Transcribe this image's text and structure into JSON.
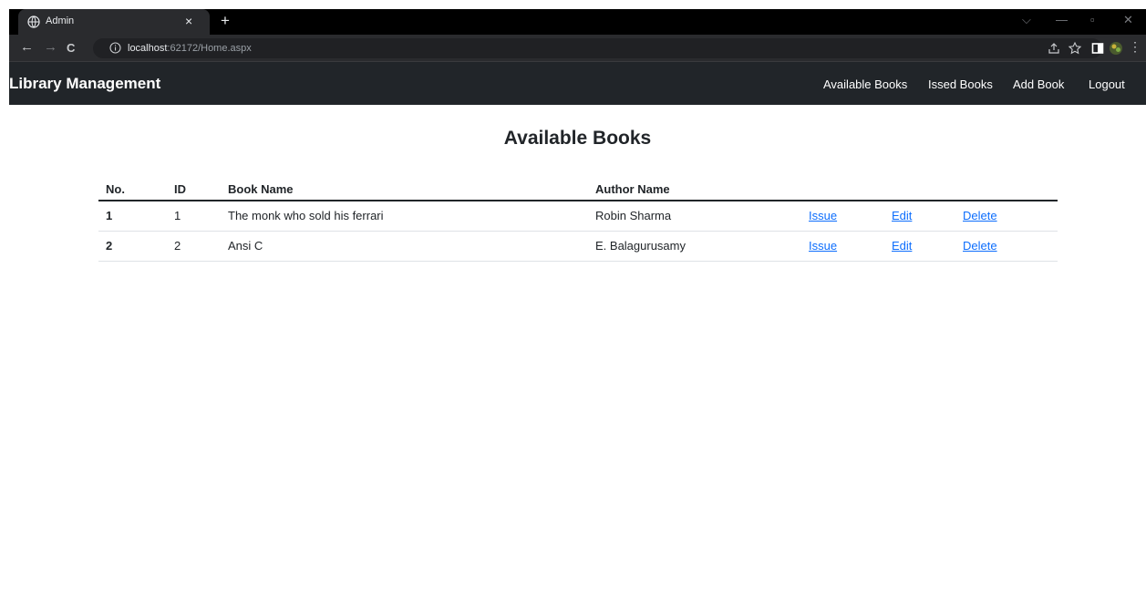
{
  "browser": {
    "tab_title": "Admin",
    "tab_close": "×",
    "new_tab": "+",
    "url_host": "localhost",
    "url_rest": ":62172/Home.aspx",
    "nav_back": "←",
    "nav_forward": "→",
    "nav_reload": "C",
    "win_minimize": "—",
    "win_restore": "▫",
    "win_close": "✕",
    "win_chevron": "⌵",
    "menu": "⋮"
  },
  "navbar": {
    "brand": "Library Management",
    "links": [
      "Available Books",
      "Issed Books",
      "Add Book",
      "Logout"
    ]
  },
  "main": {
    "title": "Available Books",
    "table": {
      "headers": [
        "No.",
        "ID",
        "Book Name",
        "Author Name"
      ],
      "rows": [
        {
          "no": "1",
          "id": "1",
          "book": "The monk who sold his ferrari",
          "author": "Robin Sharma",
          "issue": "Issue",
          "edit": "Edit",
          "delete": "Delete"
        },
        {
          "no": "2",
          "id": "2",
          "book": "Ansi C",
          "author": "E. Balagurusamy",
          "issue": "Issue",
          "edit": "Edit",
          "delete": "Delete"
        }
      ]
    }
  },
  "colors": {
    "navbar_bg": "#212529",
    "link": "#0d6efd",
    "browser_dark": "#2a2b2e"
  }
}
